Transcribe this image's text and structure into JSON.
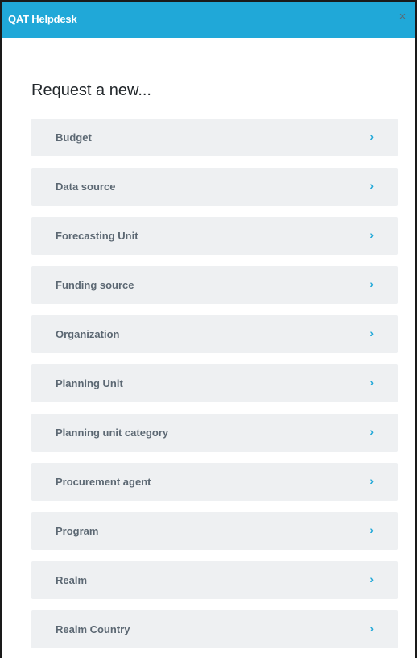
{
  "header": {
    "title": "QAT Helpdesk",
    "close_glyph": "×"
  },
  "heading": "Request a new...",
  "items": [
    {
      "label": "Budget",
      "icon": "chevron-right-icon",
      "glyph": "›"
    },
    {
      "label": "Data source",
      "icon": "chevron-right-icon",
      "glyph": "›"
    },
    {
      "label": "Forecasting Unit",
      "icon": "chevron-right-icon",
      "glyph": "›"
    },
    {
      "label": "Funding source",
      "icon": "chevron-right-icon",
      "glyph": "›"
    },
    {
      "label": "Organization",
      "icon": "chevron-right-icon",
      "glyph": "›"
    },
    {
      "label": "Planning Unit",
      "icon": "chevron-right-icon",
      "glyph": "›"
    },
    {
      "label": "Planning unit category",
      "icon": "chevron-right-icon",
      "glyph": "›"
    },
    {
      "label": "Procurement agent",
      "icon": "chevron-right-icon",
      "glyph": "›"
    },
    {
      "label": "Program",
      "icon": "chevron-right-icon",
      "glyph": "›"
    },
    {
      "label": "Realm",
      "icon": "chevron-right-icon",
      "glyph": "›"
    },
    {
      "label": "Realm Country",
      "icon": "chevron-right-icon",
      "glyph": "›"
    }
  ],
  "colors": {
    "header_bg": "#20a8d8",
    "item_bg": "#eef0f2",
    "item_text": "#5c6873",
    "chevron": "#20a8d8"
  }
}
